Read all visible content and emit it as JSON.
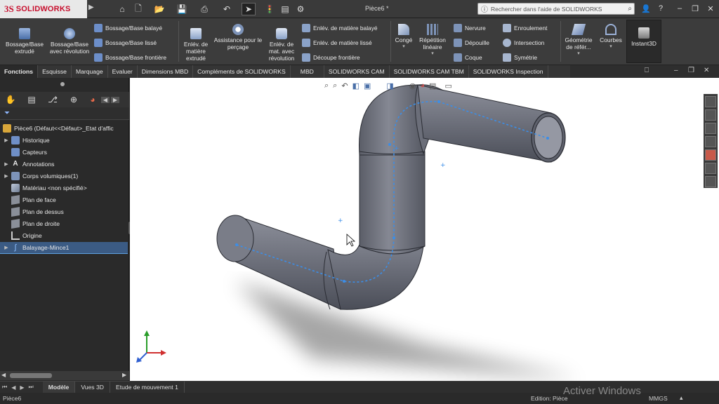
{
  "app": {
    "logo_ds": "3S",
    "logo_name": "SOLIDWORKS",
    "doc_title": "Pièce6 *",
    "search_placeholder": "Rechercher dans l'aide de SOLIDWORKS"
  },
  "ribbon": {
    "bossage_extrude": "Bossage/Base extrudé",
    "bossage_revolution": "Bossage/Base avec révolution",
    "bossage_balaye": "Bossage/Base balayé",
    "bossage_lisse": "Bossage/Base lissé",
    "bossage_frontiere": "Bossage/Base frontière",
    "enlev_extrude": "Enlév. de matière extrudé",
    "assistance_percage": "Assistance pour le perçage",
    "enlev_revolution": "Enlév. de mat. avec révolution",
    "enlev_balaye": "Enlév. de matière balayé",
    "enlev_lisse": "Enlév. de matière lissé",
    "decoupe_frontiere": "Découpe frontière",
    "conge": "Congé",
    "repetition": "Répétition linéaire",
    "nervure": "Nervure",
    "depouille": "Dépouille",
    "coque": "Coque",
    "enroulement": "Enroulement",
    "intersection": "Intersection",
    "symetrie": "Symétrie",
    "geometrie": "Géométrie de référ...",
    "courbes": "Courbes",
    "instant3d": "Instant3D"
  },
  "tabs": [
    {
      "label": "Fonctions",
      "active": true
    },
    {
      "label": "Esquisse"
    },
    {
      "label": "Marquage"
    },
    {
      "label": "Evaluer"
    },
    {
      "label": "Dimensions MBD"
    },
    {
      "label": "Compléments de SOLIDWORKS"
    },
    {
      "label": "MBD"
    },
    {
      "label": "SOLIDWORKS CAM"
    },
    {
      "label": "SOLIDWORKS CAM TBM"
    },
    {
      "label": "SOLIDWORKS Inspection"
    }
  ],
  "tree": {
    "root": "Pièce6  (Défaut<<Défaut>_Etat d'affic",
    "items": [
      {
        "label": "Historique",
        "expandable": true
      },
      {
        "label": "Capteurs",
        "expandable": false
      },
      {
        "label": "Annotations",
        "expandable": true
      },
      {
        "label": "Corps volumiques(1)",
        "expandable": true
      },
      {
        "label": "Matériau <non spécifié>",
        "expandable": false
      },
      {
        "label": "Plan de face",
        "expandable": false
      },
      {
        "label": "Plan de dessus",
        "expandable": false
      },
      {
        "label": "Plan de droite",
        "expandable": false
      },
      {
        "label": "Origine",
        "expandable": false
      },
      {
        "label": "Balayage-Mince1",
        "expandable": true,
        "selected": true
      }
    ]
  },
  "bottom_tabs": [
    {
      "label": "Modèle",
      "active": true
    },
    {
      "label": "Vues 3D"
    },
    {
      "label": "Etude de mouvement 1"
    }
  ],
  "status": {
    "left": "Pièce6",
    "edition": "Edition: Pièce",
    "units": "MMGS"
  },
  "watermark": "Activer Windows",
  "colors": {
    "accent": "#3b5b84",
    "pipe": "#6c6f7a",
    "path": "#3b8ee8"
  }
}
